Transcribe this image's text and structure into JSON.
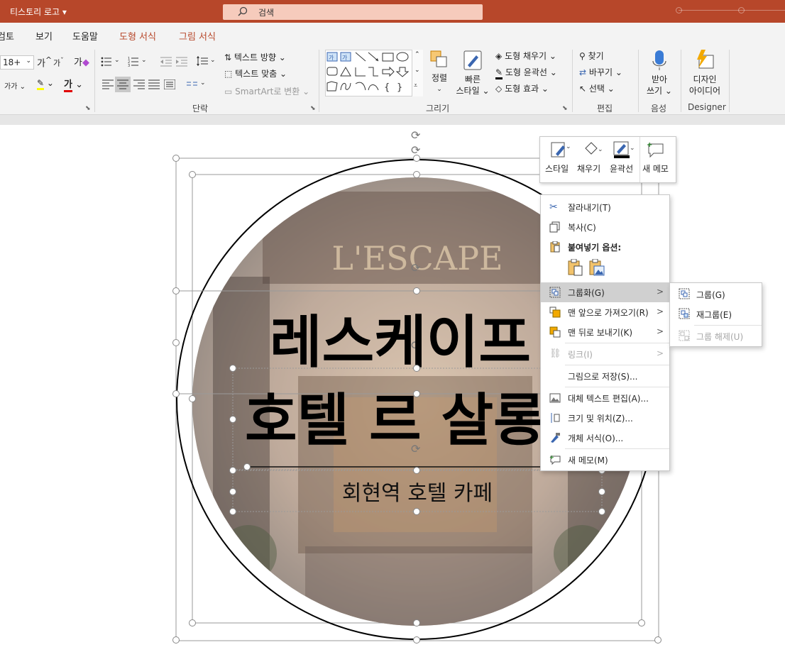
{
  "titlebar": {
    "doc_title": "티스토리 로고 ▾",
    "search_placeholder": "검색"
  },
  "tabs": [
    "검토",
    "보기",
    "도움말",
    "도형 서식",
    "그림 서식"
  ],
  "ribbon": {
    "font_size": "18+",
    "font_grow": "가",
    "font_shrink": "가",
    "font_small_label": "가가",
    "font_color_label": "가",
    "text_direction": "텍스트 방향",
    "text_align": "텍스트 맞춤",
    "smartart": "SmartArt로 변환",
    "arrange": "정렬",
    "quick_style_1": "빠른",
    "quick_style_2": "스타일",
    "shape_fill": "도형 채우기",
    "shape_outline": "도형 윤곽선",
    "shape_effects": "도형 효과",
    "find": "찾기",
    "replace": "바꾸기",
    "select": "선택",
    "dictate_1": "받아",
    "dictate_2": "쓰기",
    "designer_1": "디자인",
    "designer_2": "아이디어",
    "group_paragraph": "단락",
    "group_drawing": "그리기",
    "group_editing": "편집",
    "group_voice": "음성",
    "group_designer": "Designer"
  },
  "slide": {
    "sign_text": "L'ESCAPE",
    "title_line1": "레스케이프",
    "title_line2": "호텔 르 살롱",
    "subtitle": "회현역 호텔 카페"
  },
  "mini_toolbar": {
    "style": "스타일",
    "fill": "채우기",
    "outline": "윤곽선",
    "new_comment": "새 메모"
  },
  "context_menu": {
    "cut": "잘라내기(T)",
    "copy": "복사(C)",
    "paste_options": "붙여넣기 옵션:",
    "group": "그룹화(G)",
    "bring_front": "맨 앞으로 가져오기(R)",
    "send_back": "맨 뒤로 보내기(K)",
    "link": "링크(I)",
    "save_as_picture": "그림으로 저장(S)...",
    "edit_alt_text": "대체 텍스트 편집(A)...",
    "size_position": "크기 및 위치(Z)...",
    "format_object": "개체 서식(O)...",
    "new_comment": "새 메모(M)"
  },
  "group_submenu": {
    "group": "그룹(G)",
    "regroup": "재그룹(E)",
    "ungroup": "그룹 해제(U)"
  },
  "colors": {
    "accent": "#b7472a",
    "search_bg": "#f6cbbc",
    "menu_highlight": "#d0d0d0"
  }
}
